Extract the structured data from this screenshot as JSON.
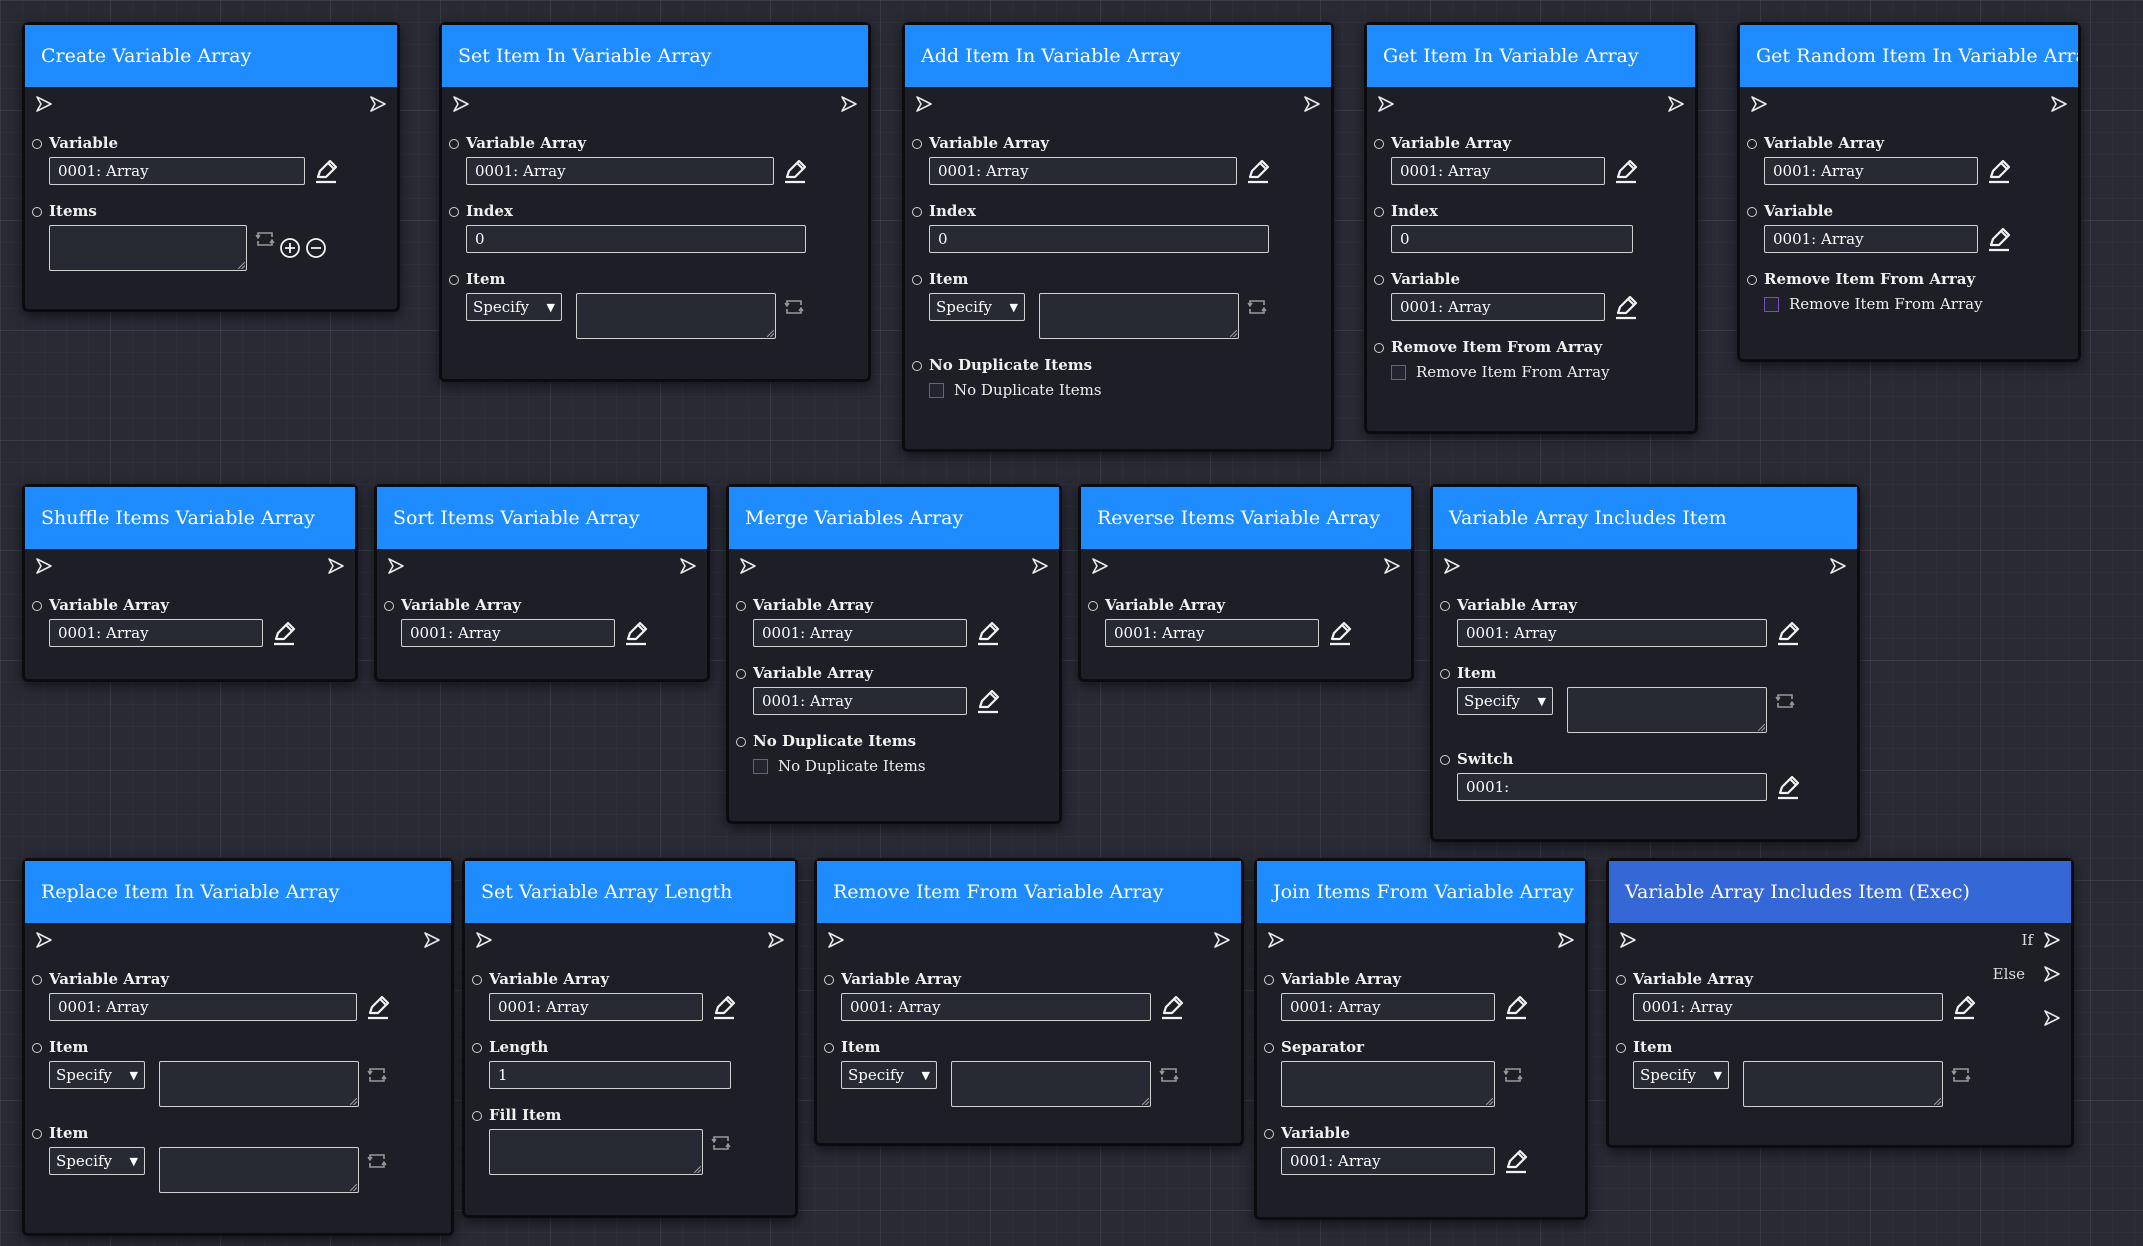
{
  "nodes": {
    "n1": {
      "title": "Create Variable Array",
      "f1": "Variable",
      "v1": "0001: Array",
      "f2": "Items"
    },
    "n2": {
      "title": "Set Item In Variable Array",
      "f1": "Variable Array",
      "v1": "0001: Array",
      "f2": "Index",
      "v2": "0",
      "f3": "Item",
      "sel3": "Specify"
    },
    "n3": {
      "title": "Add Item In Variable Array",
      "f1": "Variable Array",
      "v1": "0001: Array",
      "f2": "Index",
      "v2": "0",
      "f3": "Item",
      "sel3": "Specify",
      "f4": "No Duplicate Items",
      "cb4": "No Duplicate Items"
    },
    "n4": {
      "title": "Get Item In Variable Array",
      "f1": "Variable Array",
      "v1": "0001: Array",
      "f2": "Index",
      "v2": "0",
      "f3": "Variable",
      "v3": "0001: Array",
      "f4": "Remove Item From Array",
      "cb4": "Remove Item From Array"
    },
    "n5": {
      "title": "Get Random Item In Variable Array",
      "f1": "Variable Array",
      "v1": "0001: Array",
      "f2": "Variable",
      "v2": "0001: Array",
      "f3": "Remove Item From Array",
      "cb3": "Remove Item From Array"
    },
    "n6": {
      "title": "Shuffle Items Variable Array",
      "f1": "Variable Array",
      "v1": "0001: Array"
    },
    "n7": {
      "title": "Sort Items Variable Array",
      "f1": "Variable Array",
      "v1": "0001: Array"
    },
    "n8": {
      "title": "Merge Variables Array",
      "f1": "Variable Array",
      "v1": "0001: Array",
      "f2": "Variable Array",
      "v2": "0001: Array",
      "f3": "No Duplicate Items",
      "cb3": "No Duplicate Items"
    },
    "n9": {
      "title": "Reverse Items Variable Array",
      "f1": "Variable Array",
      "v1": "0001: Array"
    },
    "n10": {
      "title": "Variable Array Includes Item",
      "f1": "Variable Array",
      "v1": "0001: Array",
      "f2": "Item",
      "sel2": "Specify",
      "f3": "Switch",
      "v3": "0001:"
    },
    "n11": {
      "title": "Replace Item In Variable Array",
      "f1": "Variable Array",
      "v1": "0001: Array",
      "f2": "Item",
      "sel2": "Specify",
      "f3": "Item",
      "sel3": "Specify"
    },
    "n12": {
      "title": "Set Variable Array Length",
      "f1": "Variable Array",
      "v1": "0001: Array",
      "f2": "Length",
      "v2": "1",
      "f3": "Fill Item"
    },
    "n13": {
      "title": "Remove Item From Variable Array",
      "f1": "Variable Array",
      "v1": "0001: Array",
      "f2": "Item",
      "sel2": "Specify"
    },
    "n14": {
      "title": "Join Items From Variable Array",
      "f1": "Variable Array",
      "v1": "0001: Array",
      "f2": "Separator",
      "f3": "Variable",
      "v3": "0001: Array"
    },
    "n15": {
      "title": "Variable Array Includes Item (Exec)",
      "out_if": "If",
      "out_else": "Else",
      "f1": "Variable Array",
      "v1": "0001: Array",
      "f2": "Item",
      "sel2": "Specify"
    }
  },
  "colors": {
    "header": "#1e8cff",
    "header_exec": "#3667d6",
    "node_bg": "#1e1f26",
    "canvas": "#2a2a35"
  }
}
